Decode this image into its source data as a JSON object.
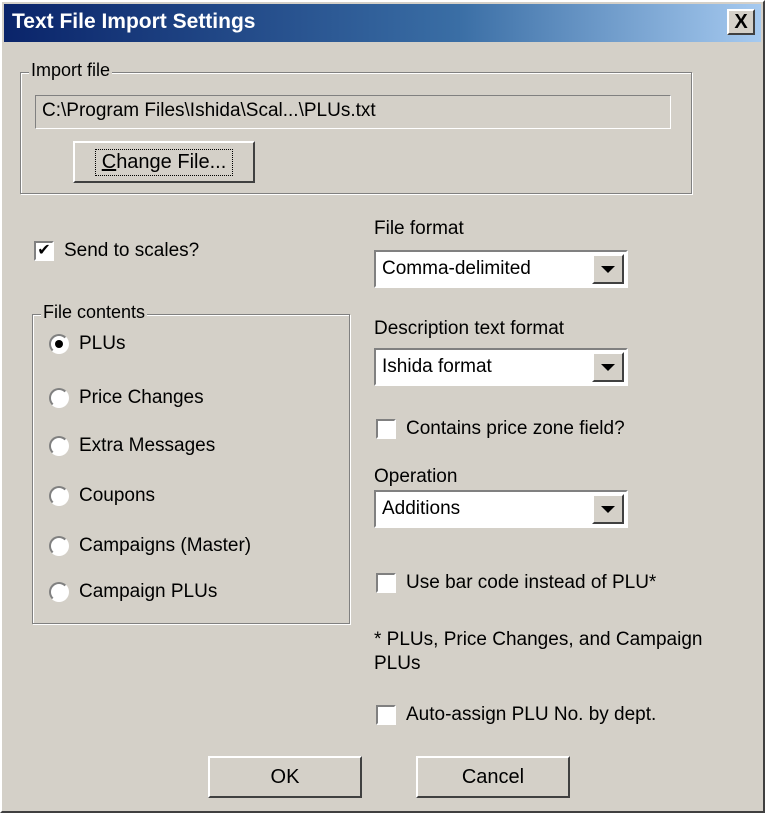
{
  "window": {
    "title": "Text File Import Settings",
    "close_glyph": "X"
  },
  "import_file": {
    "legend": "Import file",
    "path": "C:\\Program Files\\Ishida\\Scal...\\PLUs.txt",
    "change_button": "Change File..."
  },
  "send_to_scales": {
    "label": "Send to scales?",
    "checked": true
  },
  "file_contents": {
    "legend": "File contents",
    "options": [
      {
        "label": "PLUs",
        "selected": true
      },
      {
        "label": "Price Changes",
        "selected": false
      },
      {
        "label": "Extra Messages",
        "selected": false
      },
      {
        "label": "Coupons",
        "selected": false
      },
      {
        "label": "Campaigns (Master)",
        "selected": false
      },
      {
        "label": "Campaign PLUs",
        "selected": false
      }
    ]
  },
  "file_format": {
    "label": "File format",
    "value": "Comma-delimited"
  },
  "description_format": {
    "label": "Description text format",
    "value": "Ishida format"
  },
  "price_zone": {
    "label": "Contains price zone field?",
    "checked": false
  },
  "operation": {
    "label": "Operation",
    "value": "Additions"
  },
  "bar_code": {
    "label": "Use bar code instead of PLU*",
    "checked": false
  },
  "footnote": "* PLUs, Price Changes, and Campaign PLUs",
  "auto_assign": {
    "label": "Auto-assign PLU No. by dept.",
    "checked": false
  },
  "buttons": {
    "ok": "OK",
    "cancel": "Cancel"
  },
  "colors": {
    "face": "#d4d0c8",
    "title_start": "#0a246a",
    "title_end": "#a6caf0"
  }
}
